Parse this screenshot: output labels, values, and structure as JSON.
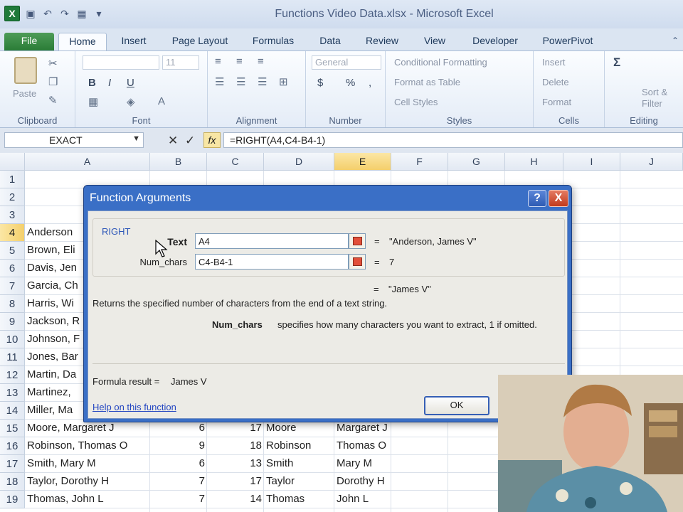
{
  "window": {
    "title": "Functions Video Data.xlsx - Microsoft Excel",
    "app_icon": "X"
  },
  "ribbon": {
    "tabs": [
      "File",
      "Home",
      "Insert",
      "Page Layout",
      "Formulas",
      "Data",
      "Review",
      "View",
      "Developer",
      "PowerPivot"
    ],
    "active_tab": "Home",
    "clipboard": {
      "paste": "Paste",
      "label": "Clipboard"
    },
    "font": {
      "size": "11",
      "label": "Font",
      "bold": "B",
      "italic": "I",
      "underline": "U"
    },
    "alignment": {
      "label": "Alignment"
    },
    "number": {
      "format": "General",
      "currency": "$",
      "percent": "%",
      "comma": ",",
      "label": "Number"
    },
    "styles": {
      "conditional": "Conditional Formatting",
      "format_table": "Format as Table",
      "cell_styles": "Cell Styles",
      "label": "Styles"
    },
    "cells": {
      "insert": "Insert",
      "delete": "Delete",
      "format": "Format",
      "label": "Cells"
    },
    "editing": {
      "sigma": "Σ",
      "sort": "Sort &",
      "filter": "Filter",
      "label": "Editing"
    }
  },
  "formula_bar": {
    "name_box": "EXACT",
    "formula": "=RIGHT(A4,C4-B4-1)"
  },
  "grid": {
    "columns": [
      "A",
      "B",
      "C",
      "D",
      "E",
      "F",
      "G",
      "H",
      "I",
      "J"
    ],
    "selected_column": "E",
    "selected_row": "4",
    "rows": [
      {
        "n": "1",
        "a": "",
        "b": "",
        "c": "",
        "d": "",
        "e": ""
      },
      {
        "n": "2",
        "a": "",
        "b": "",
        "c": "",
        "d": "",
        "e": ""
      },
      {
        "n": "3",
        "a": "",
        "b": "",
        "c": "",
        "d": "",
        "e": ""
      },
      {
        "n": "4",
        "a": "Anderson",
        "b": "",
        "c": "",
        "d": "",
        "e": ""
      },
      {
        "n": "5",
        "a": "Brown, Eli",
        "b": "",
        "c": "",
        "d": "",
        "e": ""
      },
      {
        "n": "6",
        "a": "Davis, Jen",
        "b": "",
        "c": "",
        "d": "",
        "e": ""
      },
      {
        "n": "7",
        "a": "Garcia, Ch",
        "b": "",
        "c": "",
        "d": "",
        "e": ""
      },
      {
        "n": "8",
        "a": "Harris, Wi",
        "b": "",
        "c": "",
        "d": "",
        "e": ""
      },
      {
        "n": "9",
        "a": "Jackson, R",
        "b": "",
        "c": "",
        "d": "",
        "e": ""
      },
      {
        "n": "10",
        "a": "Johnson, F",
        "b": "",
        "c": "",
        "d": "",
        "e": ""
      },
      {
        "n": "11",
        "a": "Jones, Bar",
        "b": "",
        "c": "",
        "d": "",
        "e": ""
      },
      {
        "n": "12",
        "a": "Martin, Da",
        "b": "",
        "c": "",
        "d": "",
        "e": ""
      },
      {
        "n": "13",
        "a": "Martinez,",
        "b": "",
        "c": "",
        "d": "",
        "e": ""
      },
      {
        "n": "14",
        "a": "Miller, Ma",
        "b": "",
        "c": "",
        "d": "",
        "e": ""
      },
      {
        "n": "15",
        "a": "Moore, Margaret J",
        "b": "6",
        "c": "17",
        "d": "Moore",
        "e": "Margaret J"
      },
      {
        "n": "16",
        "a": "Robinson, Thomas O",
        "b": "9",
        "c": "18",
        "d": "Robinson",
        "e": "Thomas O"
      },
      {
        "n": "17",
        "a": "Smith, Mary M",
        "b": "6",
        "c": "13",
        "d": "Smith",
        "e": "Mary M"
      },
      {
        "n": "18",
        "a": "Taylor, Dorothy H",
        "b": "7",
        "c": "17",
        "d": "Taylor",
        "e": "Dorothy H"
      },
      {
        "n": "19",
        "a": "Thomas, John L",
        "b": "7",
        "c": "14",
        "d": "Thomas",
        "e": "John L"
      }
    ]
  },
  "dialog": {
    "title": "Function Arguments",
    "help_btn": "?",
    "close_btn": "X",
    "function_name": "RIGHT",
    "args": [
      {
        "label": "Text",
        "value": "A4",
        "eq": "=",
        "result": "\"Anderson, James V\""
      },
      {
        "label": "Num_chars",
        "value": "C4-B4-1",
        "eq": "=",
        "result": "7"
      }
    ],
    "overall_eq": "=",
    "overall_result": "\"James V\"",
    "description": "Returns the specified number of characters from the end of a text string.",
    "arg_desc_name": "Num_chars",
    "arg_desc_text": "specifies how many characters you want to extract, 1 if omitted.",
    "formula_result_label": "Formula result =",
    "formula_result_value": "James V",
    "help_link": "Help on this function",
    "ok": "OK"
  }
}
